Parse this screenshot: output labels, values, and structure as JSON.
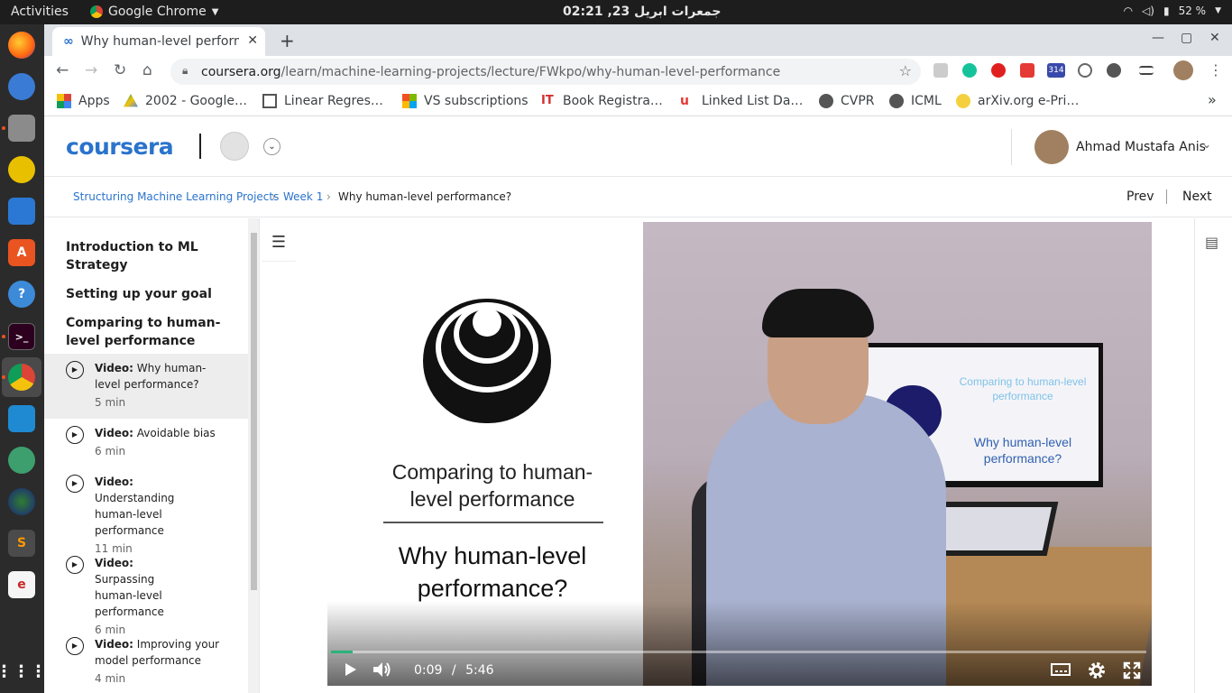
{
  "os": {
    "activities_label": "Activities",
    "app_name": "Google Chrome",
    "clock": "جمعرات ابریل 23, 02:21",
    "battery": "52 %"
  },
  "browser": {
    "tab_title": "Why human-level perform",
    "url_host": "coursera.org",
    "url_path": "/learn/machine-learning-projects/lecture/FWkpo/why-human-level-performance",
    "extension_badge": "314",
    "bookmarks": [
      "Apps",
      "2002 - Google…",
      "Linear Regres…",
      "VS subscriptions",
      "Book Registra…",
      "Linked List Da…",
      "CVPR",
      "ICML",
      "arXiv.org e-Pri…"
    ],
    "bookmarks_more": "»"
  },
  "header": {
    "logo": "coursera",
    "user_name": "Ahmad Mustafa Anis"
  },
  "breadcrumb": {
    "course": "Structuring Machine Learning Projects",
    "week": "Week 1",
    "current": "Why human-level performance?",
    "separator": "›",
    "prev": "Prev",
    "next": "Next"
  },
  "sidebar": {
    "sections": [
      "Introduction to ML Strategy",
      "Setting up your goal",
      "Comparing to human-level performance"
    ],
    "items": [
      {
        "kind": "Video:",
        "title": "Why human-level performance?",
        "duration": "5 min",
        "active": true
      },
      {
        "kind": "Video:",
        "title": "Avoidable bias",
        "duration": "6 min",
        "active": false
      },
      {
        "kind": "Video:",
        "title": "Understanding human-level performance",
        "duration": "11 min",
        "active": false
      },
      {
        "kind": "Video:",
        "title": "Surpassing human-level performance",
        "duration": "6 min",
        "active": false
      },
      {
        "kind": "Video:",
        "title": "Improving your model performance",
        "duration": "4 min",
        "active": false
      }
    ]
  },
  "video": {
    "slide_subtitle": "Comparing to human-level performance",
    "slide_title": "Why human-level performance?",
    "monitor_subtitle": "Comparing to human-level performance",
    "monitor_title": "Why human-level performance?",
    "current_time": "0:09",
    "time_separator": "/",
    "duration": "5:46",
    "progress_fraction": 0.026
  },
  "colors": {
    "coursera_blue": "#2a73cc",
    "progress_green": "#2ab27b"
  }
}
